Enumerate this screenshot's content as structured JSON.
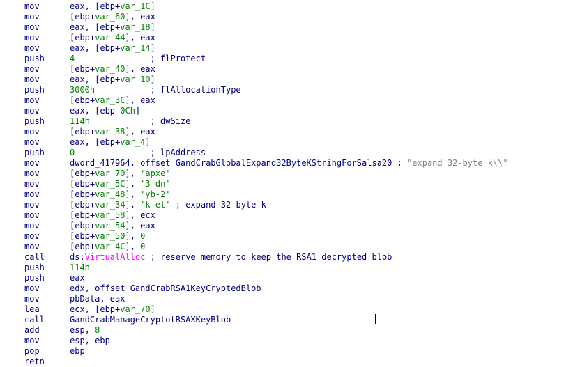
{
  "lines": [
    {
      "mnemonic": "mov",
      "operands": [
        {
          "t": "eax, [ebp+",
          "c": "b"
        },
        {
          "t": "var_1C",
          "c": "g"
        },
        {
          "t": "]",
          "c": "b"
        }
      ]
    },
    {
      "mnemonic": "mov",
      "operands": [
        {
          "t": "[ebp+",
          "c": "b"
        },
        {
          "t": "var_60",
          "c": "g"
        },
        {
          "t": "], eax",
          "c": "b"
        }
      ]
    },
    {
      "mnemonic": "mov",
      "operands": [
        {
          "t": "eax, [ebp+",
          "c": "b"
        },
        {
          "t": "var_18",
          "c": "g"
        },
        {
          "t": "]",
          "c": "b"
        }
      ]
    },
    {
      "mnemonic": "mov",
      "operands": [
        {
          "t": "[ebp+",
          "c": "b"
        },
        {
          "t": "var_44",
          "c": "g"
        },
        {
          "t": "], eax",
          "c": "b"
        }
      ]
    },
    {
      "mnemonic": "mov",
      "operands": [
        {
          "t": "eax, [ebp+",
          "c": "b"
        },
        {
          "t": "var_14",
          "c": "g"
        },
        {
          "t": "]",
          "c": "b"
        }
      ]
    },
    {
      "mnemonic": "push",
      "operands": [
        {
          "t": "4",
          "c": "g"
        },
        {
          "t": "               ; flProtect",
          "c": "b"
        }
      ]
    },
    {
      "mnemonic": "mov",
      "operands": [
        {
          "t": "[ebp+",
          "c": "b"
        },
        {
          "t": "var_40",
          "c": "g"
        },
        {
          "t": "], eax",
          "c": "b"
        }
      ]
    },
    {
      "mnemonic": "mov",
      "operands": [
        {
          "t": "eax, [ebp+",
          "c": "b"
        },
        {
          "t": "var_10",
          "c": "g"
        },
        {
          "t": "]",
          "c": "b"
        }
      ]
    },
    {
      "mnemonic": "push",
      "operands": [
        {
          "t": "3000h",
          "c": "g"
        },
        {
          "t": "           ; flAllocationType",
          "c": "b"
        }
      ]
    },
    {
      "mnemonic": "mov",
      "operands": [
        {
          "t": "[ebp+",
          "c": "b"
        },
        {
          "t": "var_3C",
          "c": "g"
        },
        {
          "t": "], eax",
          "c": "b"
        }
      ]
    },
    {
      "mnemonic": "mov",
      "operands": [
        {
          "t": "eax, [ebp-",
          "c": "b"
        },
        {
          "t": "0Ch",
          "c": "g"
        },
        {
          "t": "]",
          "c": "b"
        }
      ]
    },
    {
      "mnemonic": "push",
      "operands": [
        {
          "t": "114h",
          "c": "g"
        },
        {
          "t": "            ; dwSize",
          "c": "b"
        }
      ]
    },
    {
      "mnemonic": "mov",
      "operands": [
        {
          "t": "[ebp+",
          "c": "b"
        },
        {
          "t": "var_38",
          "c": "g"
        },
        {
          "t": "], eax",
          "c": "b"
        }
      ]
    },
    {
      "mnemonic": "mov",
      "operands": [
        {
          "t": "eax, [ebp+",
          "c": "b"
        },
        {
          "t": "var_4",
          "c": "g"
        },
        {
          "t": "]",
          "c": "b"
        }
      ]
    },
    {
      "mnemonic": "push",
      "operands": [
        {
          "t": "0",
          "c": "g"
        },
        {
          "t": "               ; lpAddress",
          "c": "b"
        }
      ]
    },
    {
      "mnemonic": "mov",
      "operands": [
        {
          "t": "dword_417964, offset GandCrabGlobalExpand32ByteKStringForSalsa20 ; ",
          "c": "b"
        },
        {
          "t": "\"expand 32-byte k\\\\\"",
          "c": "s"
        }
      ]
    },
    {
      "mnemonic": "mov",
      "operands": [
        {
          "t": "[ebp+",
          "c": "b"
        },
        {
          "t": "var_70",
          "c": "g"
        },
        {
          "t": "], ",
          "c": "b"
        },
        {
          "t": "'apxe'",
          "c": "g"
        }
      ]
    },
    {
      "mnemonic": "mov",
      "operands": [
        {
          "t": "[ebp+",
          "c": "b"
        },
        {
          "t": "var_5C",
          "c": "g"
        },
        {
          "t": "], ",
          "c": "b"
        },
        {
          "t": "'3 dn'",
          "c": "g"
        }
      ]
    },
    {
      "mnemonic": "mov",
      "operands": [
        {
          "t": "[ebp+",
          "c": "b"
        },
        {
          "t": "var_48",
          "c": "g"
        },
        {
          "t": "], ",
          "c": "b"
        },
        {
          "t": "'yb-2'",
          "c": "g"
        }
      ]
    },
    {
      "mnemonic": "mov",
      "operands": [
        {
          "t": "[ebp+",
          "c": "b"
        },
        {
          "t": "var_34",
          "c": "g"
        },
        {
          "t": "], ",
          "c": "b"
        },
        {
          "t": "'k et'",
          "c": "g"
        },
        {
          "t": " ; expand 32-byte k",
          "c": "b"
        }
      ]
    },
    {
      "mnemonic": "mov",
      "operands": [
        {
          "t": "[ebp+",
          "c": "b"
        },
        {
          "t": "var_58",
          "c": "g"
        },
        {
          "t": "], ecx",
          "c": "b"
        }
      ]
    },
    {
      "mnemonic": "mov",
      "operands": [
        {
          "t": "[ebp+",
          "c": "b"
        },
        {
          "t": "var_54",
          "c": "g"
        },
        {
          "t": "], eax",
          "c": "b"
        }
      ]
    },
    {
      "mnemonic": "mov",
      "operands": [
        {
          "t": "[ebp+",
          "c": "b"
        },
        {
          "t": "var_50",
          "c": "g"
        },
        {
          "t": "], ",
          "c": "b"
        },
        {
          "t": "0",
          "c": "g"
        }
      ]
    },
    {
      "mnemonic": "mov",
      "operands": [
        {
          "t": "[ebp+",
          "c": "b"
        },
        {
          "t": "var_4C",
          "c": "g"
        },
        {
          "t": "], ",
          "c": "b"
        },
        {
          "t": "0",
          "c": "g"
        }
      ]
    },
    {
      "mnemonic": "call",
      "operands": [
        {
          "t": "ds:",
          "c": "b"
        },
        {
          "t": "VirtualAlloc",
          "c": "r"
        },
        {
          "t": " ; reserve memory to keep the RSA1 decrypted blob",
          "c": "b"
        }
      ]
    },
    {
      "mnemonic": "push",
      "operands": [
        {
          "t": "114h",
          "c": "g"
        }
      ]
    },
    {
      "mnemonic": "push",
      "operands": [
        {
          "t": "eax",
          "c": "b"
        }
      ]
    },
    {
      "mnemonic": "mov",
      "operands": [
        {
          "t": "edx, offset GandCrabRSA1KeyCryptedBlob",
          "c": "b"
        }
      ]
    },
    {
      "mnemonic": "mov",
      "operands": [
        {
          "t": "pbData, eax",
          "c": "b"
        }
      ]
    },
    {
      "mnemonic": "lea",
      "operands": [
        {
          "t": "ecx, [ebp+",
          "c": "b"
        },
        {
          "t": "var_70",
          "c": "g"
        },
        {
          "t": "]",
          "c": "b"
        }
      ]
    },
    {
      "mnemonic": "call",
      "operands": [
        {
          "t": "GandCrabManageCryptotRSAXKeyBlob",
          "c": "b"
        }
      ]
    },
    {
      "mnemonic": "add",
      "operands": [
        {
          "t": "esp, ",
          "c": "b"
        },
        {
          "t": "8",
          "c": "g"
        }
      ]
    },
    {
      "mnemonic": "mov",
      "operands": [
        {
          "t": "esp, ebp",
          "c": "b"
        }
      ]
    },
    {
      "mnemonic": "pop",
      "operands": [
        {
          "t": "ebp",
          "c": "b"
        }
      ]
    },
    {
      "mnemonic": "retn",
      "operands": []
    }
  ]
}
